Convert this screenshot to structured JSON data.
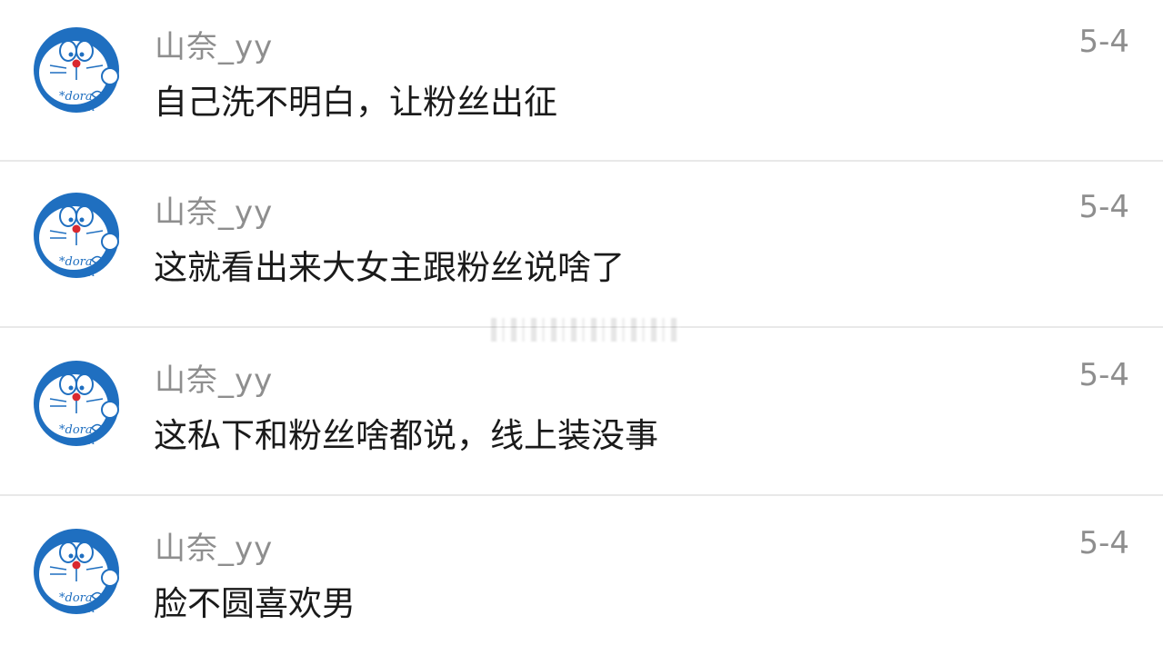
{
  "comments": [
    {
      "username": "山奈_yy",
      "date": "5-4",
      "text": "自己洗不明白，让粉丝出征",
      "avatar": "doraemon-avatar-icon"
    },
    {
      "username": "山奈_yy",
      "date": "5-4",
      "text": "这就看出来大女主跟粉丝说啥了",
      "avatar": "doraemon-avatar-icon"
    },
    {
      "username": "山奈_yy",
      "date": "5-4",
      "text": "这私下和粉丝啥都说，线上装没事",
      "avatar": "doraemon-avatar-icon"
    },
    {
      "username": "山奈_yy",
      "date": "5-4",
      "text": "脸不圆喜欢男",
      "avatar": "doraemon-avatar-icon"
    }
  ],
  "colors": {
    "avatar_blue": "#1f6fc0",
    "meta_gray": "#8e8e8e",
    "text": "#1a1a1a",
    "divider": "#e8e8e8"
  }
}
